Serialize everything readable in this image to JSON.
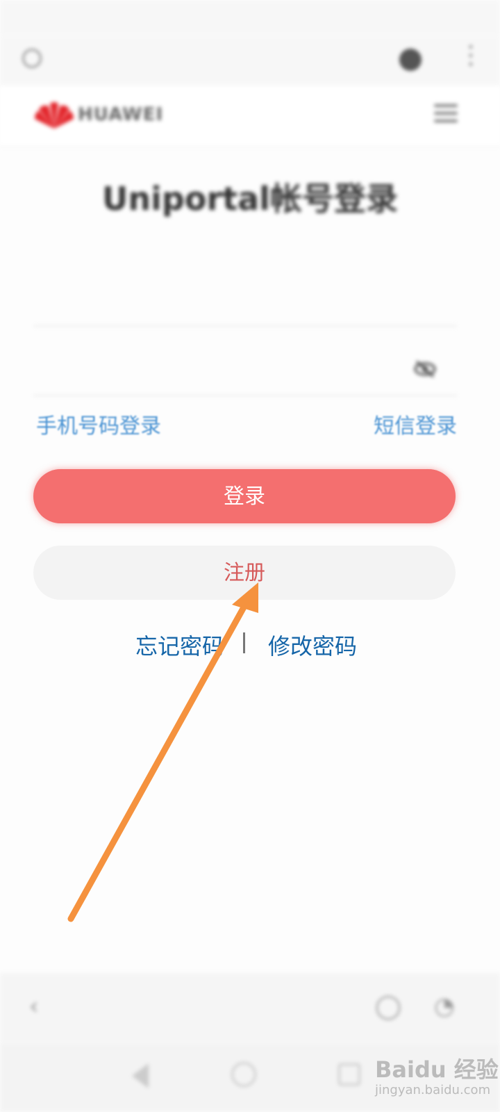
{
  "status_bar": {
    "left": "",
    "right": ""
  },
  "browser": {
    "title": "",
    "icons": [
      "search-icon",
      "account-icon",
      "more-vertical-icon"
    ]
  },
  "header": {
    "brand": "HUAWEI",
    "icons": [
      "huawei-logo",
      "menu-icon"
    ]
  },
  "page": {
    "title": "Uniportal帐号登录",
    "username_placeholder": "",
    "password_placeholder": ""
  },
  "links": {
    "phone_login": "手机号码登录",
    "sms_login": "短信登录",
    "forgot_password": "忘记密码",
    "divider": "|",
    "change_password": "修改密码"
  },
  "buttons": {
    "login": "登录",
    "register": "注册"
  },
  "watermark": {
    "brand": "Baidu 经验",
    "sub": "jingyan.baidu.com"
  },
  "colors": {
    "login_button": "#f46f6f",
    "register_text": "#d65a5a",
    "link_blue": "#1565a8",
    "arrow": "#f5923e"
  }
}
